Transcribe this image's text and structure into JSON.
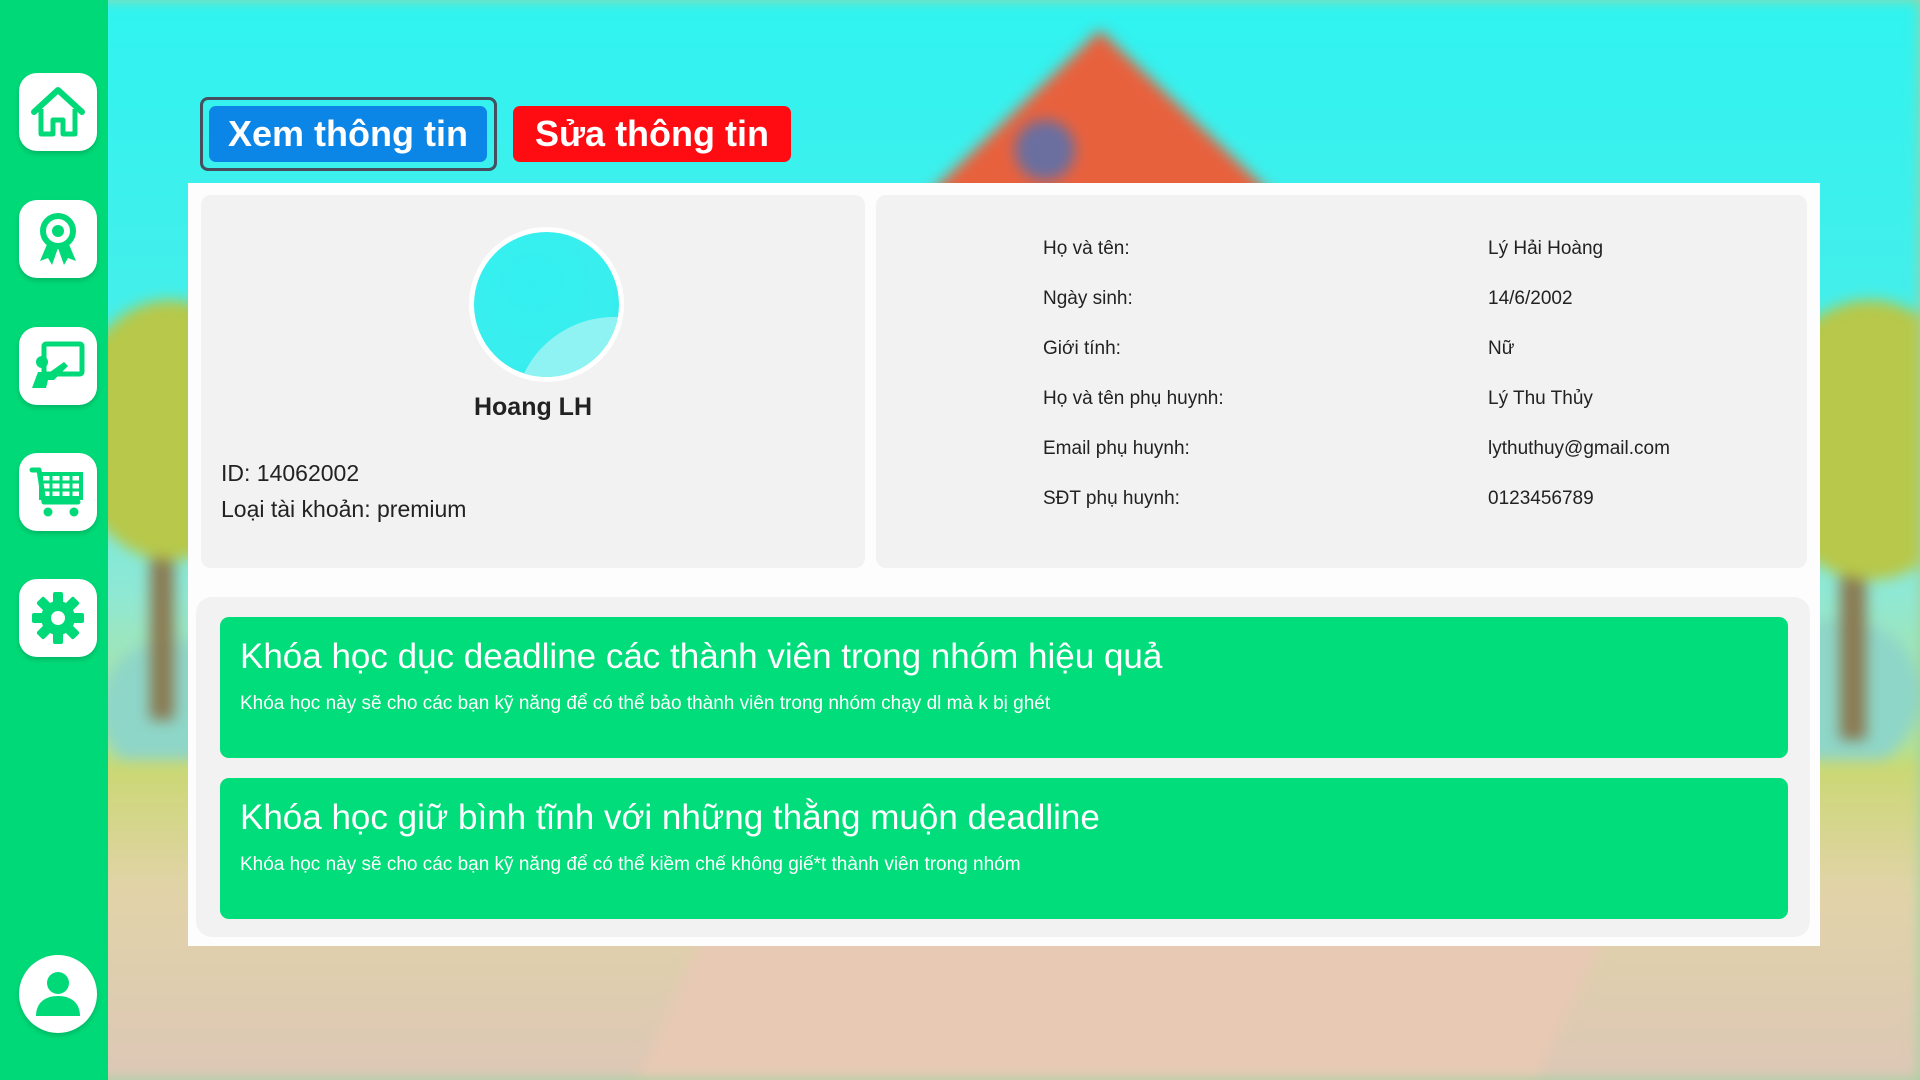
{
  "tabs": {
    "view_label": "Xem thông tin",
    "edit_label": "Sửa thông tin",
    "active": "view",
    "view_color": "#0b85e6",
    "edit_color": "#ff0b12"
  },
  "sidebar": {
    "color": "#00d977",
    "items": [
      {
        "icon": "home-icon"
      },
      {
        "icon": "award-ribbon-icon"
      },
      {
        "icon": "classroom-board-icon"
      },
      {
        "icon": "shopping-cart-icon"
      },
      {
        "icon": "gear-icon"
      },
      {
        "icon": "user-icon"
      }
    ]
  },
  "profile": {
    "name": "Hoang LH",
    "id_line": "ID: 14062002",
    "account_type_line": "Loại tài khoản: premium"
  },
  "info": {
    "rows": [
      {
        "label": "Họ và tên:",
        "value": "Lý Hải Hoàng"
      },
      {
        "label": "Ngày sinh:",
        "value": "14/6/2002"
      },
      {
        "label": "Giới tính:",
        "value": "Nữ"
      },
      {
        "label": "Họ và tên phụ huynh:",
        "value": "Lý Thu Thủy"
      },
      {
        "label": "Email phụ huynh:",
        "value": "lythuthuy@gmail.com"
      },
      {
        "label": "SĐT phụ huynh:",
        "value": "0123456789"
      }
    ]
  },
  "courses": [
    {
      "title": "Khóa học dục deadline các thành viên trong nhóm hiệu quả",
      "description": "Khóa học này sẽ cho các bạn kỹ năng để có thể bảo thành viên trong nhóm chạy dl mà k bị ghét"
    },
    {
      "title": "Khóa học giữ bình tĩnh với những thằng muộn deadline",
      "description": "Khóa học này sẽ cho các bạn kỹ năng để có thể kiềm chế không giế*t thành viên trong nhóm"
    }
  ],
  "colors": {
    "course_card": "#00dd7a",
    "card_bg": "#f2f2f2"
  }
}
